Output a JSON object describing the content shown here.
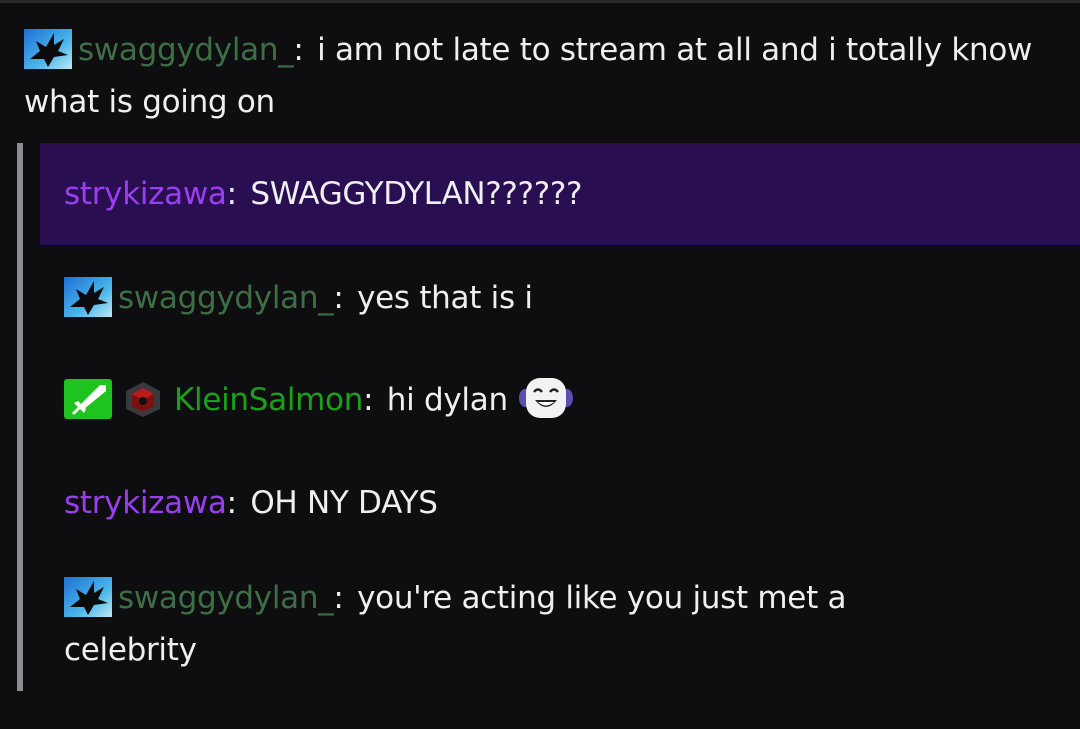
{
  "colors": {
    "background": "#0e0e10",
    "text": "#efeff1",
    "swaggydylan_name": "#3e6e46",
    "strykizawa_name": "#9a3ff0",
    "kleinsalmon_name": "#1aa01a",
    "highlight_bg": "#2a0e52",
    "quote_bar": "#8d8d92"
  },
  "main_message": {
    "username": "swaggydylan_",
    "colon": ":",
    "text": "i am not late to stream at all and i totally know what is going on",
    "badge_icon": "bird-badge-icon"
  },
  "thread": [
    {
      "username": "strykizawa",
      "colon": ":",
      "text": "SWAGGYDYLAN??????",
      "highlighted": true
    },
    {
      "username": "swaggydylan_",
      "colon": ":",
      "text": "yes that is i",
      "badge_icon": "bird-badge-icon"
    },
    {
      "username": "KleinSalmon",
      "colon": ":",
      "text": "hi dylan",
      "badge_icons": [
        "sword-moderator-icon",
        "cube-badge-icon"
      ],
      "emote": "smiling-face-emote"
    },
    {
      "username": "strykizawa",
      "colon": ":",
      "text": "OH NY DAYS"
    },
    {
      "username": "swaggydylan_",
      "colon": ":",
      "text": "you're acting like you just met a celebrity",
      "badge_icon": "bird-badge-icon"
    }
  ]
}
